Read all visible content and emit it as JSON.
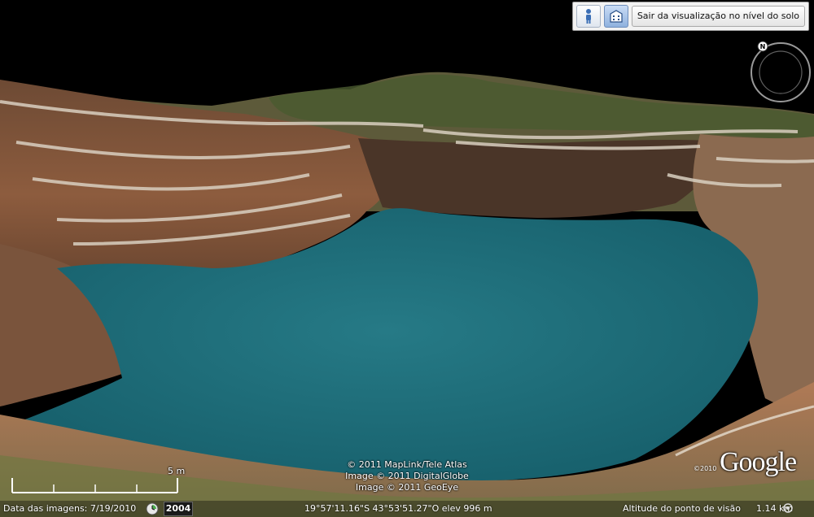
{
  "toolbar": {
    "street_view_icon": "person-icon",
    "building_icon": "3d-buildings-icon",
    "exit_label": "Sair da visualização no nível do solo"
  },
  "navigation": {
    "north_label": "N"
  },
  "attribution": {
    "line1": "© 2011 MapLink/Tele Atlas",
    "line2": "Image © 2011 DigitalGlobe",
    "line3": "Image © 2011 GeoEye"
  },
  "logo": {
    "text": "Google",
    "copyright": "©2010"
  },
  "scale": {
    "label": "5 m"
  },
  "status": {
    "image_date": "Data das imagens: 7/19/2010",
    "year": "2004",
    "coordinates": "19°57'11.16\"S   43°53'51.27\"O   elev  996 m",
    "eye_alt_label": "Altitude do ponto de visão",
    "eye_alt_value": "1.14 km"
  },
  "colors": {
    "water": "#1f6b78",
    "rock": "#8a5a3c",
    "sky": "#000000"
  }
}
